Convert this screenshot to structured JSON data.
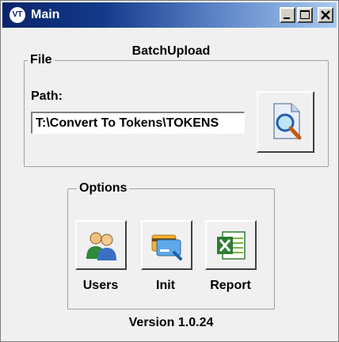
{
  "window": {
    "title": "Main",
    "icon_text": "VT",
    "icon": "vt-app-icon",
    "controls": [
      "minimize-icon",
      "maximize-icon",
      "close-icon"
    ]
  },
  "header": {
    "app_title": "BatchUpload"
  },
  "file_group": {
    "legend": "File",
    "path_label": "Path:",
    "path_value": "T:\\Convert To Tokens\\TOKENS",
    "browse_icon": "magnifier-document-icon"
  },
  "options_group": {
    "legend": "Options",
    "buttons": [
      {
        "label": "Users",
        "icon": "users-icon"
      },
      {
        "label": "Init",
        "icon": "card-init-icon"
      },
      {
        "label": "Report",
        "icon": "excel-report-icon"
      }
    ]
  },
  "footer": {
    "version": "Version 1.0.24"
  },
  "colors": {
    "titlebar_start": "#0a246a",
    "titlebar_end": "#a6caf0",
    "window_bg": "#f0f0f0"
  }
}
